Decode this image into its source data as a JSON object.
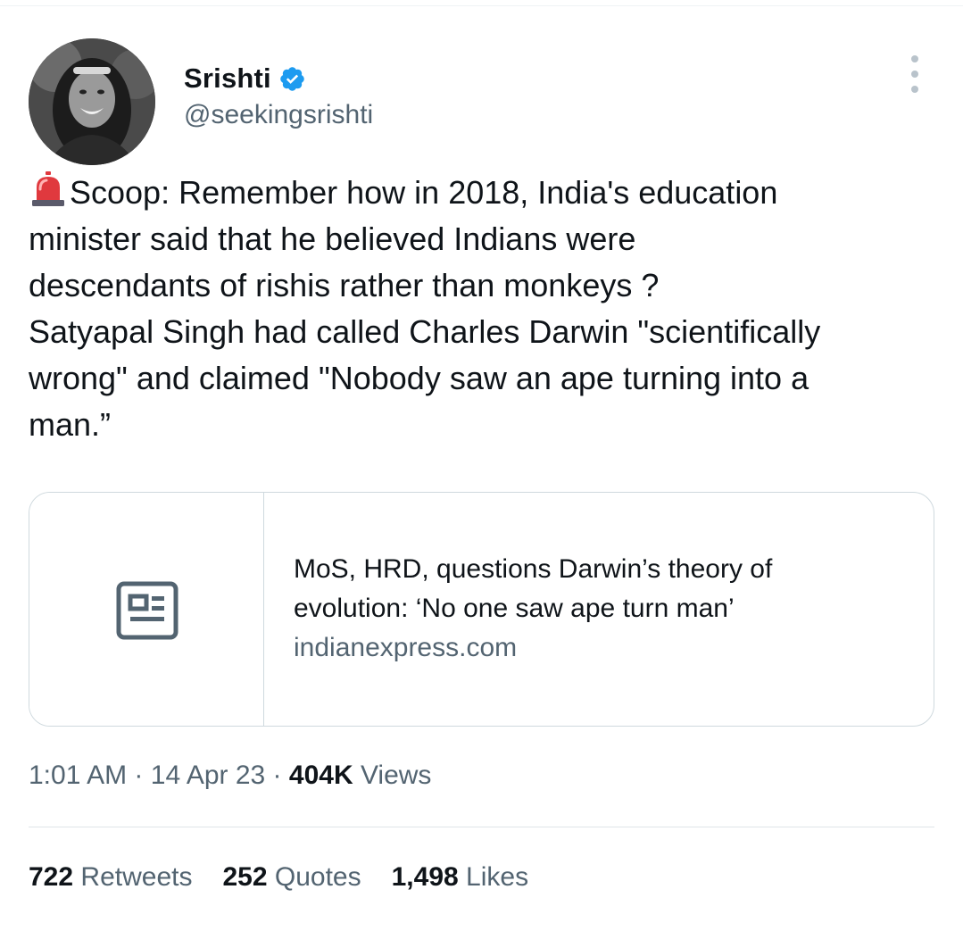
{
  "author": {
    "display_name": "Srishti",
    "handle": "@seekingsrishti",
    "verified": true,
    "verified_color": "#1d9bf0"
  },
  "tweet": {
    "lines": [
      "Scoop: Remember how in 2018, India's education",
      "minister said that he believed Indians were",
      "descendants of rishis rather than monkeys ?",
      "Satyapal Singh had called Charles Darwin \"scientifically",
      "wrong\" and claimed \"Nobody saw an ape turning into a",
      "man.”"
    ],
    "leading_emoji": "siren-emoji"
  },
  "link_card": {
    "title_line1": "MoS, HRD, questions Darwin’s theory of",
    "title_line2": "evolution: ‘No one saw ape turn man’",
    "domain": "indianexpress.com",
    "thumbnail_icon": "article-icon"
  },
  "meta": {
    "time": "1:01 AM",
    "separator": "·",
    "date": "14 Apr 23",
    "views_count": "404K",
    "views_label": "Views"
  },
  "stats": {
    "retweets_count": "722",
    "retweets_label": "Retweets",
    "quotes_count": "252",
    "quotes_label": "Quotes",
    "likes_count": "1,498",
    "likes_label": "Likes"
  },
  "colors": {
    "text_primary": "#0f1419",
    "text_secondary": "#536471",
    "border": "#cfd9de",
    "accent": "#1d9bf0"
  }
}
